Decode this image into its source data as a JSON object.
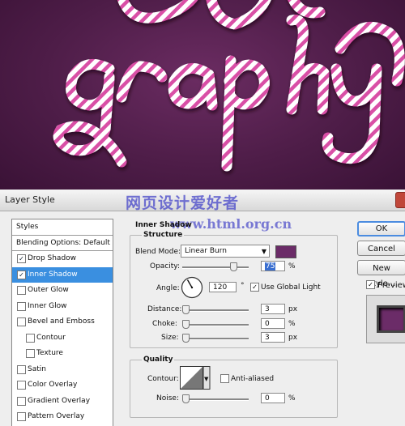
{
  "artwork": {
    "text": "graphy",
    "top_text_fragment": "ra",
    "rope_colors": [
      "#ffffff",
      "#d94fa6"
    ],
    "background": "#4e1d48"
  },
  "dialog": {
    "title": "Layer Style",
    "watermark_1": "网页设计爱好者",
    "watermark_2": "www.html.org.cn",
    "styles_list": [
      {
        "label": "Styles",
        "type": "header"
      },
      {
        "label": "Blending Options: Default",
        "type": "header"
      },
      {
        "label": "Drop Shadow",
        "checked": true
      },
      {
        "label": "Inner Shadow",
        "checked": true,
        "selected": true
      },
      {
        "label": "Outer Glow",
        "checked": false
      },
      {
        "label": "Inner Glow",
        "checked": false
      },
      {
        "label": "Bevel and Emboss",
        "checked": false
      },
      {
        "label": "Contour",
        "checked": false,
        "indent": true
      },
      {
        "label": "Texture",
        "checked": false,
        "indent": true
      },
      {
        "label": "Satin",
        "checked": false
      },
      {
        "label": "Color Overlay",
        "checked": false
      },
      {
        "label": "Gradient Overlay",
        "checked": false
      },
      {
        "label": "Pattern Overlay",
        "checked": false
      }
    ],
    "panel": {
      "title": "Inner Shadow",
      "structure": {
        "title": "Structure",
        "blend_mode_label": "Blend Mode:",
        "blend_mode_value": "Linear Burn",
        "blend_color": "#6b2c68",
        "opacity_label": "Opacity:",
        "opacity_value": "75",
        "opacity_unit": "%",
        "opacity_fraction": 0.75,
        "angle_label": "Angle:",
        "angle_value": "120",
        "angle_unit": "°",
        "angle_degrees": 120,
        "global_light_label": "Use Global Light",
        "global_light_checked": true,
        "distance_label": "Distance:",
        "distance_value": "3",
        "distance_unit": "px",
        "choke_label": "Choke:",
        "choke_value": "0",
        "choke_unit": "%",
        "size_label": "Size:",
        "size_value": "3",
        "size_unit": "px"
      },
      "quality": {
        "title": "Quality",
        "contour_label": "Contour:",
        "anti_aliased_label": "Anti-aliased",
        "anti_aliased_checked": false,
        "noise_label": "Noise:",
        "noise_value": "0",
        "noise_unit": "%"
      }
    },
    "buttons": {
      "ok": "OK",
      "cancel": "Cancel",
      "new_style": "New Style..."
    },
    "preview_label": "Preview",
    "preview_checked": true
  }
}
